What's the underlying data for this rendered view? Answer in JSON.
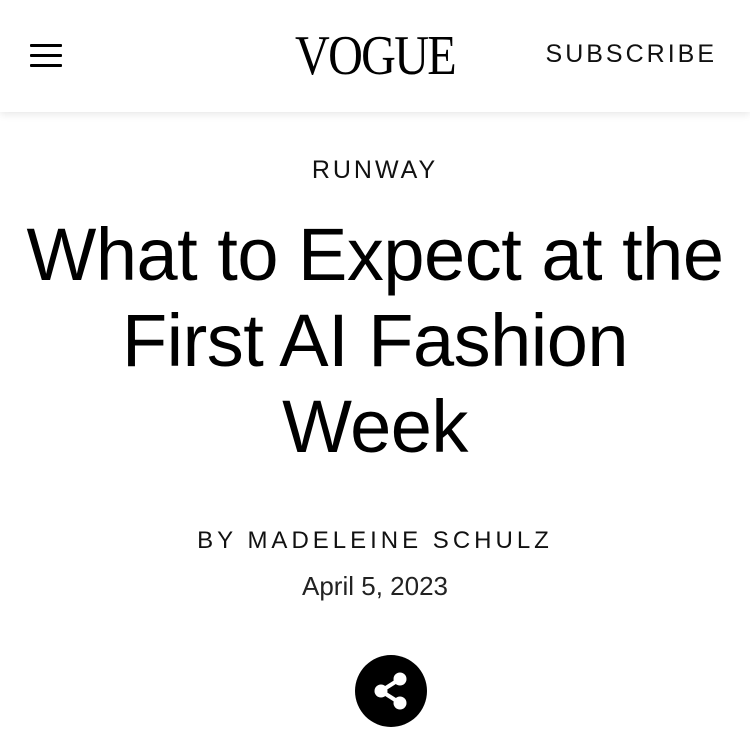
{
  "header": {
    "logo": "VOGUE",
    "subscribe_label": "SUBSCRIBE",
    "menu_icon": "hamburger-menu-icon"
  },
  "article": {
    "rubric": "RUNWAY",
    "title": "What to Expect at the First AI Fashion Week",
    "byline_prefix": "BY",
    "author": "MADELEINE SCHULZ",
    "date": "April 5, 2023",
    "share_icon": "share-icon"
  },
  "colors": {
    "background": "#ffffff",
    "text": "#000000",
    "share_button": "#000000"
  }
}
